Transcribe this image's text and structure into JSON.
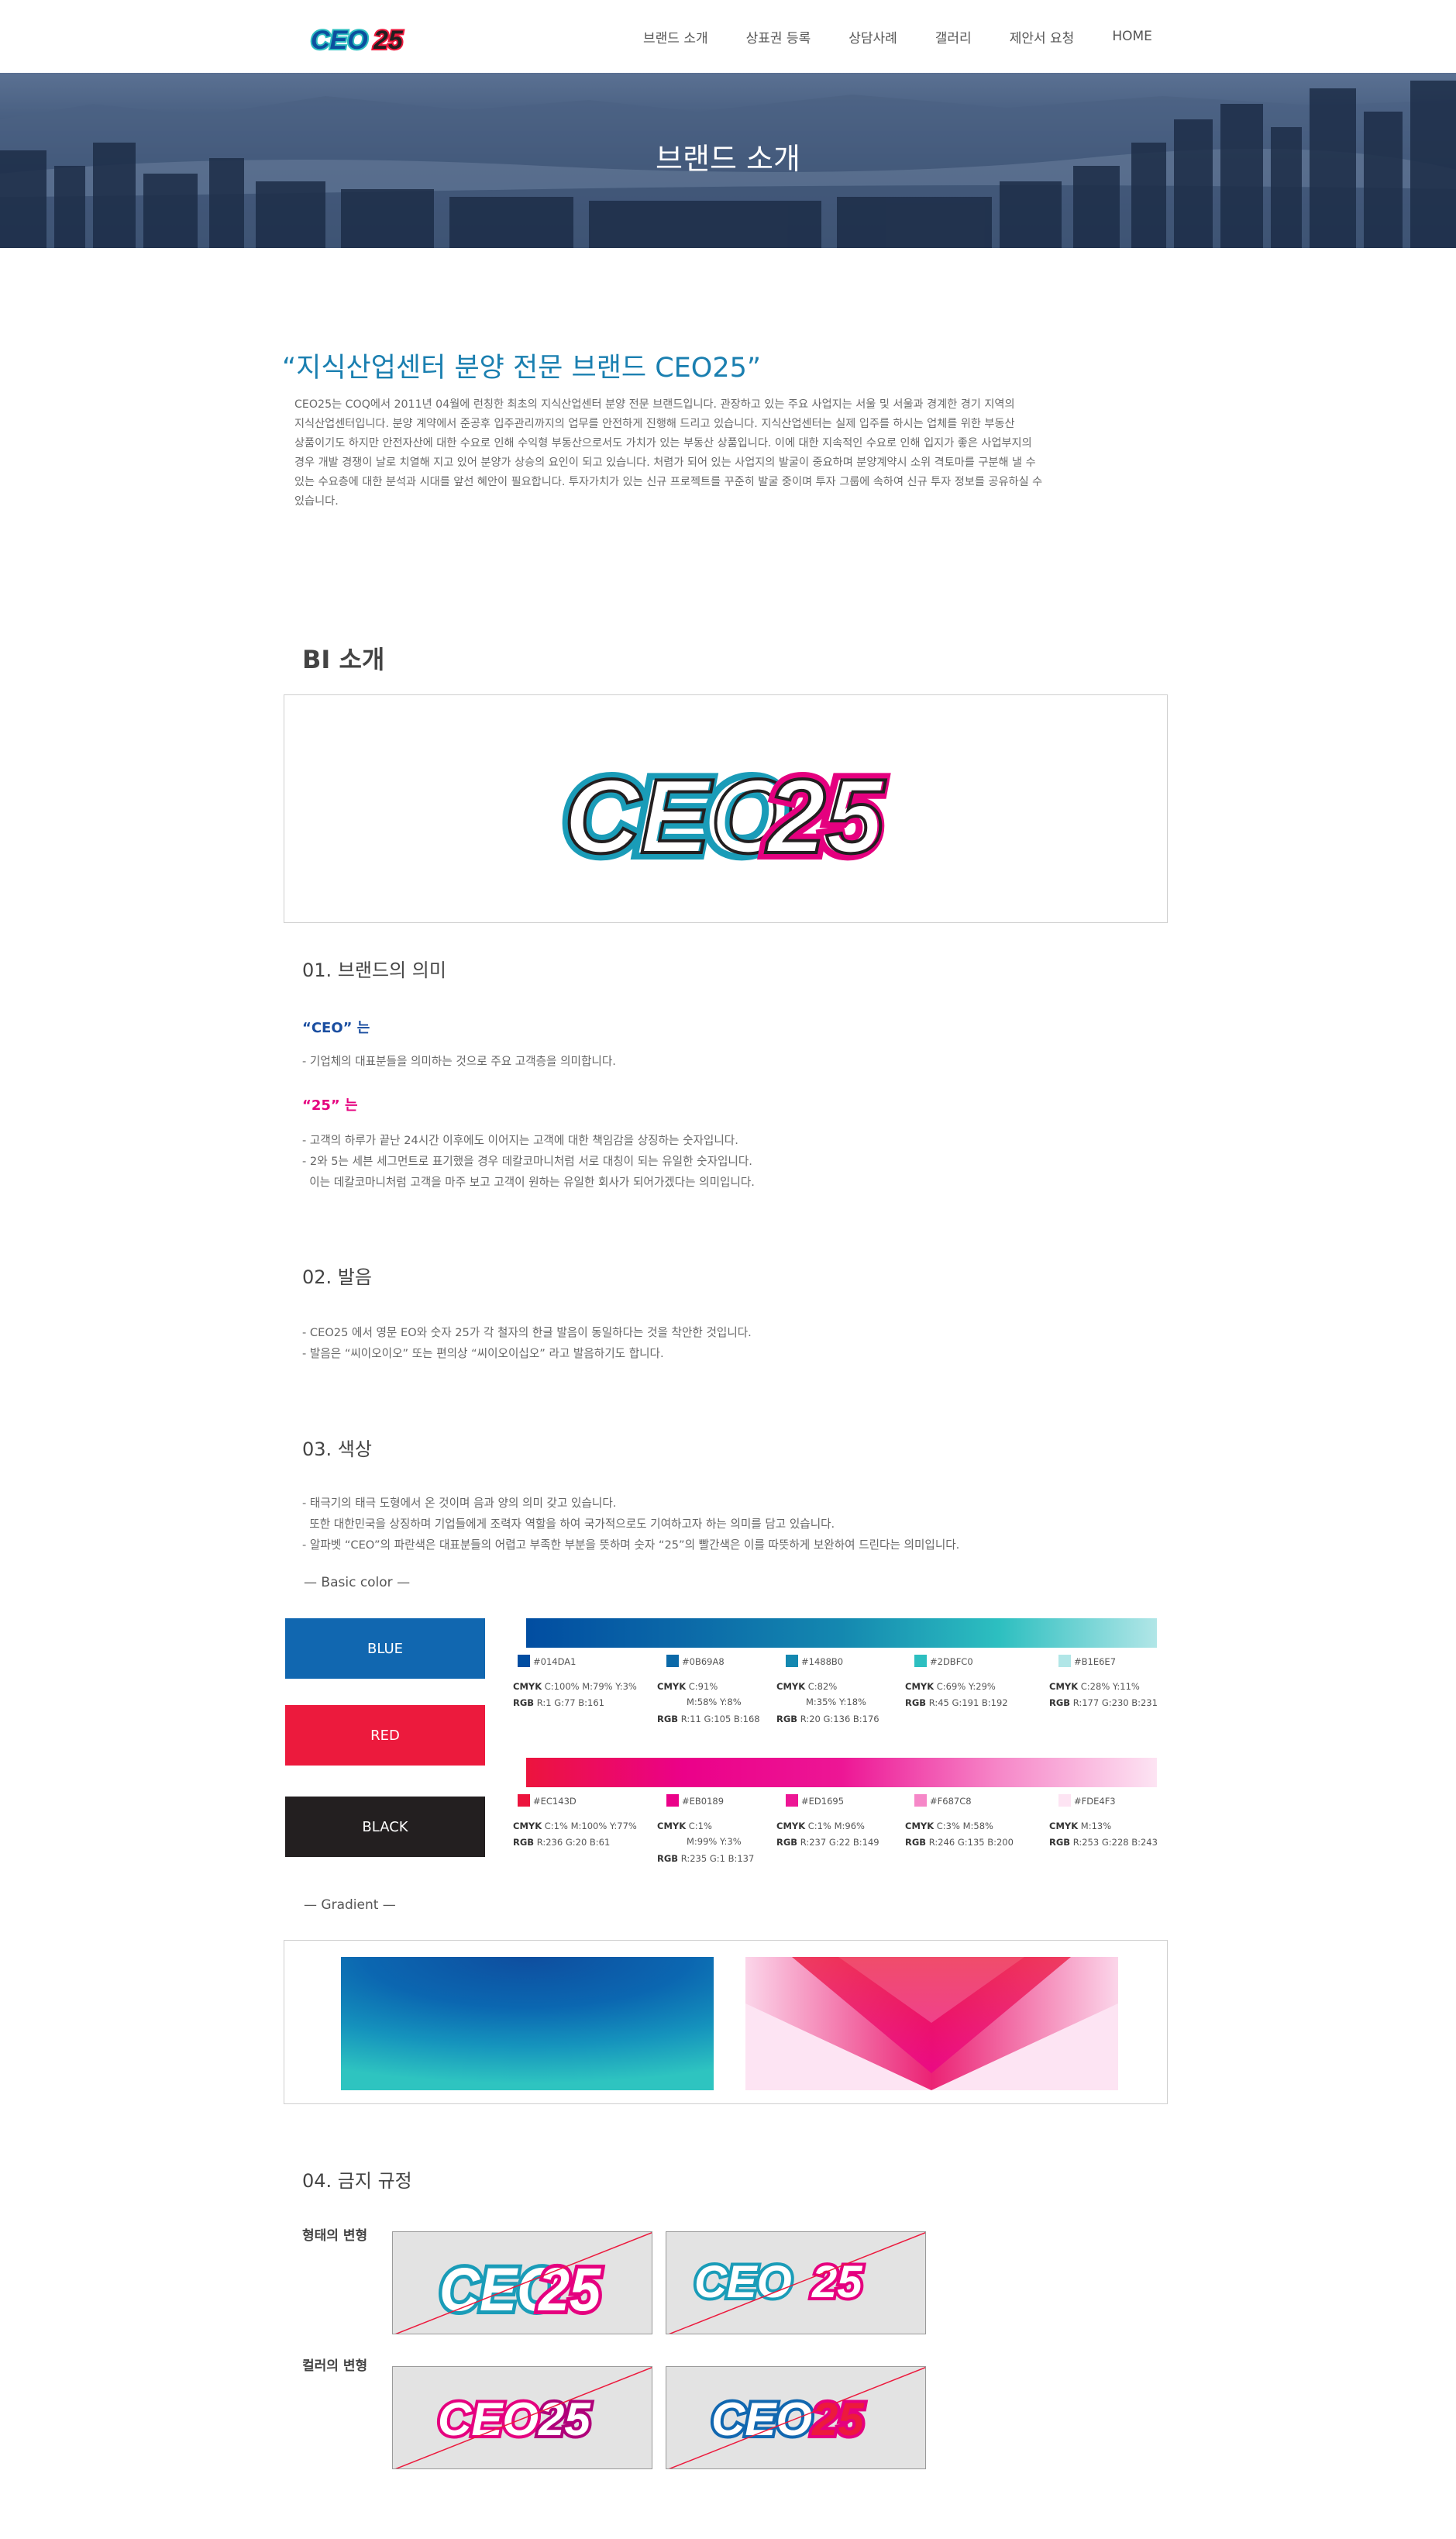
{
  "header": {
    "logo_text": "CEO25",
    "nav": [
      {
        "label": "브랜드 소개"
      },
      {
        "label": "상표권 등록"
      },
      {
        "label": "상담사례"
      },
      {
        "label": "갤러리"
      },
      {
        "label": "제안서 요청"
      },
      {
        "label": "HOME"
      }
    ]
  },
  "banner": {
    "title": "브랜드 소개"
  },
  "intro": {
    "slogan": "“지식산업센터 분양 전문 브랜드 CEO25”",
    "paragraph_lines": [
      "CEO25는 COQ에서 2011년 04월에 런칭한 최초의 지식산업센터 분양 전문 브랜드입니다. 관장하고 있는 주요 사업지는 서울 및 서울과 경계한 경기 지역의",
      "지식산업센터입니다. 분양 계약에서 준공후 입주관리까지의 업무를 안전하게 진행해 드리고 있습니다. 지식산업센터는 실제 입주를 하시는 업체를 위한 부동산",
      "상품이기도 하지만 안전자산에 대한 수요로 인해 수익형 부동산으로서도 가치가 있는 부동산 상품입니다. 이에 대한 지속적인 수요로 인해 입지가 좋은 사업부지의",
      "경우 개발 경쟁이 날로 치열해 지고 있어 분양가 상승의 요인이 되고 있습니다. 처렴가 되어 있는 사업지의 발굴이 중요하며 분양계약시 소위 격토마를 구분해 낼 수",
      "있는 수요층에 대한 분석과 시대를 앞선 혜안이 필요합니다. 투자가치가 있는 신규 프로젝트를 꾸준히 발굴 중이며 투자 그룹에 속하여 신규 투자 정보를 공유하실 수",
      "있습니다."
    ]
  },
  "bi": {
    "title": "BI 소개",
    "logo_text": "CEO25"
  },
  "meaning": {
    "title": "01. 브랜드의 의미",
    "ceo_heading": "“CEO” 는",
    "ceo_lines": [
      "- 기업체의 대표분들을 의미하는 것으로 주요 고객층을 의미합니다."
    ],
    "num_heading": "“25” 는",
    "num_lines": [
      "- 고객의 하루가 끝난 24시간 이후에도 이어지는 고객에 대한 책임감을 상징하는 숫자입니다.",
      "- 2와 5는 세븐 세그먼트로 표기했을 경우 데칼코마니처럼 서로 대칭이 되는 유일한 숫자입니다.",
      "  이는 데칼코마니처럼 고객을 마주 보고 고객이 원하는 유일한 회사가 되어가겠다는 의미입니다."
    ]
  },
  "pronunciation": {
    "title": "02. 발음",
    "lines": [
      "- CEO25 에서 영문 EO와 숫자 25가 각 철자의 한글 발음이 동일하다는 것을 착안한 것입니다.",
      "- 발음은 “씨이오이오” 또는 편의상 “씨이오이십오” 라고 발음하기도 합니다."
    ]
  },
  "colors": {
    "title": "03. 색상",
    "lines": [
      "- 태극기의 태극 도형에서 온 것이며 음과 양의 의미 갖고 있습니다.",
      "  또한 대한민국을 상징하며 기업들에게 조력자 역할을 하여 국가적으로도 기여하고자 하는 의미를 담고 있습니다.",
      "- 알파벳 “CEO”의 파란색은 대표분들의 어렵고 부족한 부분을 뜻하며 숫자 “25”의 빨간색은 이를 따뜻하게 보완하여 드린다는 의미입니다."
    ],
    "basic_label": "— Basic color —",
    "gradient_label": "— Gradient —",
    "swatches": [
      {
        "label": "BLUE",
        "color": "#1167b0"
      },
      {
        "label": "RED",
        "color": "#ec1a3d"
      },
      {
        "label": "BLACK",
        "color": "#231f20"
      }
    ],
    "blue_set": [
      {
        "hex": "#014DA1",
        "color": "#014DA1",
        "cmyk_k": "CMYK",
        "cmyk": "C:100% M:79% Y:3%",
        "cmyk2": "",
        "rgb_k": "RGB",
        "rgb": "R:1 G:77 B:161",
        "rgb_under": false
      },
      {
        "hex": "#0B69A8",
        "color": "#0B69A8",
        "cmyk_k": "CMYK",
        "cmyk": "C:91%",
        "cmyk2": "M:58% Y:8%",
        "rgb_k": "RGB",
        "rgb": "R:11 G:105 B:168",
        "rgb_under": true
      },
      {
        "hex": "#1488B0",
        "color": "#1488B0",
        "cmyk_k": "CMYK",
        "cmyk": "C:82%",
        "cmyk2": "M:35% Y:18%",
        "rgb_k": "RGB",
        "rgb": "R:20 G:136 B:176",
        "rgb_under": true
      },
      {
        "hex": "#2DBFC0",
        "color": "#2DBFC0",
        "cmyk_k": "CMYK",
        "cmyk": "C:69% Y:29%",
        "cmyk2": "",
        "rgb_k": "RGB",
        "rgb": "R:45 G:191 B:192",
        "rgb_under": false
      },
      {
        "hex": "#B1E6E7",
        "color": "#B1E6E7",
        "cmyk_k": "CMYK",
        "cmyk": "C:28% Y:11%",
        "cmyk2": "",
        "rgb_k": "RGB",
        "rgb": "R:177 G:230 B:231",
        "rgb_under": false
      }
    ],
    "red_set": [
      {
        "hex": "#EC143D",
        "color": "#EC143D",
        "cmyk_k": "CMYK",
        "cmyk": "C:1% M:100% Y:77%",
        "cmyk2": "",
        "rgb_k": "RGB",
        "rgb": "R:236 G:20 B:61",
        "rgb_under": false
      },
      {
        "hex": "#EB0189",
        "color": "#EB0189",
        "cmyk_k": "CMYK",
        "cmyk": "C:1%",
        "cmyk2": "M:99% Y:3%",
        "rgb_k": "RGB",
        "rgb": "R:235 G:1 B:137",
        "rgb_under": true
      },
      {
        "hex": "#ED1695",
        "color": "#ED1695",
        "cmyk_k": "CMYK",
        "cmyk": "C:1% M:96%",
        "cmyk2": "",
        "rgb_k": "RGB",
        "rgb": "R:237 G:22 B:149",
        "rgb_under": false
      },
      {
        "hex": "#F687C8",
        "color": "#F687C8",
        "cmyk_k": "CMYK",
        "cmyk": "C:3% M:58%",
        "cmyk2": "",
        "rgb_k": "RGB",
        "rgb": "R:246 G:135 B:200",
        "rgb_under": false
      },
      {
        "hex": "#FDE4F3",
        "color": "#FDE4F3",
        "cmyk_k": "CMYK",
        "cmyk": "M:13%",
        "cmyk2": "",
        "rgb_k": "RGB",
        "rgb": "R:253 G:228 B:243",
        "rgb_under": false
      }
    ]
  },
  "rules": {
    "title": "04. 금지 규정",
    "shape_label": "형태의 변형",
    "color_label": "컬러의 변형",
    "logo_text": "CEO25"
  }
}
